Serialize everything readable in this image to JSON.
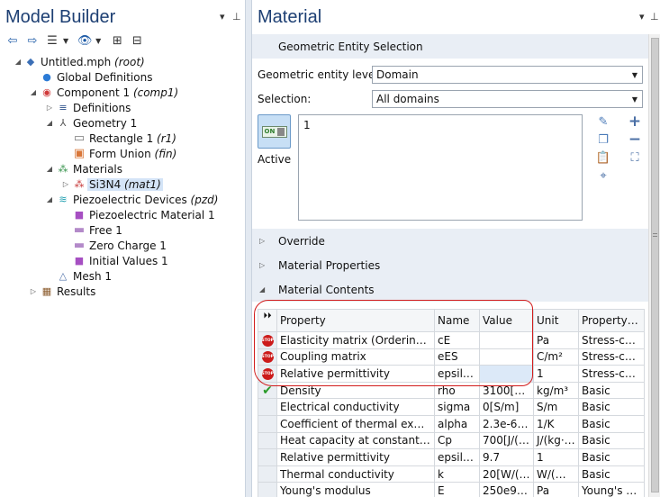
{
  "left_panel": {
    "title": "Model Builder",
    "tree": [
      {
        "label": "Untitled.mph",
        "tag": "(root)",
        "icon": "model-root-icon",
        "level": 0,
        "toggle": "expanded"
      },
      {
        "label": "Global Definitions",
        "tag": "",
        "icon": "globe-icon",
        "level": 1,
        "toggle": "none"
      },
      {
        "label": "Component 1",
        "tag": "(comp1)",
        "icon": "component-icon",
        "level": 1,
        "toggle": "expanded"
      },
      {
        "label": "Definitions",
        "tag": "",
        "icon": "definitions-icon",
        "level": 2,
        "toggle": "collapsed"
      },
      {
        "label": "Geometry 1",
        "tag": "",
        "icon": "geometry-icon",
        "level": 2,
        "toggle": "expanded"
      },
      {
        "label": "Rectangle 1",
        "tag": "(r1)",
        "icon": "rectangle-icon",
        "level": 3,
        "toggle": "none"
      },
      {
        "label": "Form Union",
        "tag": "(fin)",
        "icon": "form-union-icon",
        "level": 3,
        "toggle": "none"
      },
      {
        "label": "Materials",
        "tag": "",
        "icon": "materials-icon",
        "level": 2,
        "toggle": "expanded"
      },
      {
        "label": "Si3N4",
        "tag": "(mat1)",
        "icon": "material-error-icon",
        "level": 3,
        "toggle": "collapsed",
        "selected": true
      },
      {
        "label": "Piezoelectric Devices",
        "tag": "(pzd)",
        "icon": "piezo-physics-icon",
        "level": 2,
        "toggle": "expanded"
      },
      {
        "label": "Piezoelectric Material 1",
        "tag": "",
        "icon": "domain-feature-icon",
        "level": 3,
        "toggle": "none"
      },
      {
        "label": "Free 1",
        "tag": "",
        "icon": "boundary-feature-icon",
        "level": 3,
        "toggle": "none"
      },
      {
        "label": "Zero Charge 1",
        "tag": "",
        "icon": "boundary-feature-icon",
        "level": 3,
        "toggle": "none"
      },
      {
        "label": "Initial Values 1",
        "tag": "",
        "icon": "domain-feature-icon",
        "level": 3,
        "toggle": "none"
      },
      {
        "label": "Mesh 1",
        "tag": "",
        "icon": "mesh-icon",
        "level": 2,
        "toggle": "none"
      },
      {
        "label": "Results",
        "tag": "",
        "icon": "results-icon",
        "level": 1,
        "toggle": "collapsed"
      }
    ]
  },
  "right_panel": {
    "title": "Material",
    "sections": {
      "geometric_entity_selection": "Geometric Entity Selection",
      "override": "Override",
      "material_properties": "Material Properties",
      "material_contents": "Material Contents"
    },
    "geometric_entity_level": {
      "label": "Geometric entity level:",
      "value": "Domain"
    },
    "selection": {
      "label": "Selection:",
      "value": "All domains",
      "list_value": "1"
    },
    "active": {
      "toggle_text": "ON",
      "label": "Active"
    },
    "table": {
      "headers": [
        "Property",
        "Name",
        "Value",
        "Unit",
        "Property group"
      ],
      "rows": [
        {
          "status": "error",
          "property": "Elasticity matrix (Ordering: xx,...",
          "name": "cE",
          "value": "",
          "unit": "Pa",
          "group": "Stress-charge"
        },
        {
          "status": "error",
          "property": "Coupling matrix",
          "name": "eES",
          "value": "",
          "unit": "C/m²",
          "group": "Stress-charge"
        },
        {
          "status": "error",
          "property": "Relative permittivity",
          "name": "epsilon...",
          "value": "",
          "unit": "1",
          "group": "Stress-charge"
        },
        {
          "status": "ok",
          "property": "Density",
          "name": "rho",
          "value": "3100[kg/...",
          "unit": "kg/m³",
          "group": "Basic"
        },
        {
          "status": "",
          "property": "Electrical conductivity",
          "name": "sigma",
          "value": "0[S/m]",
          "unit": "S/m",
          "group": "Basic"
        },
        {
          "status": "",
          "property": "Coefficient of thermal expansion",
          "name": "alpha",
          "value": "2.3e-6[1/...",
          "unit": "1/K",
          "group": "Basic"
        },
        {
          "status": "",
          "property": "Heat capacity at constant pres...",
          "name": "Cp",
          "value": "700[J/(kg...",
          "unit": "J/(kg·K)",
          "group": "Basic"
        },
        {
          "status": "",
          "property": "Relative permittivity",
          "name": "epsilonr",
          "value": "9.7",
          "unit": "1",
          "group": "Basic"
        },
        {
          "status": "",
          "property": "Thermal conductivity",
          "name": "k",
          "value": "20[W/(m...",
          "unit": "W/(m·K)",
          "group": "Basic"
        },
        {
          "status": "",
          "property": "Young's modulus",
          "name": "E",
          "value": "250e9[Pa]",
          "unit": "Pa",
          "group": "Young's mod"
        }
      ]
    }
  },
  "colors": {
    "title_blue": "#1d3f73",
    "section_bg": "#e9eef5",
    "error_red": "#cc1b1b",
    "ok_green": "#2a9b2a",
    "annotation_red": "#d21c1c"
  }
}
